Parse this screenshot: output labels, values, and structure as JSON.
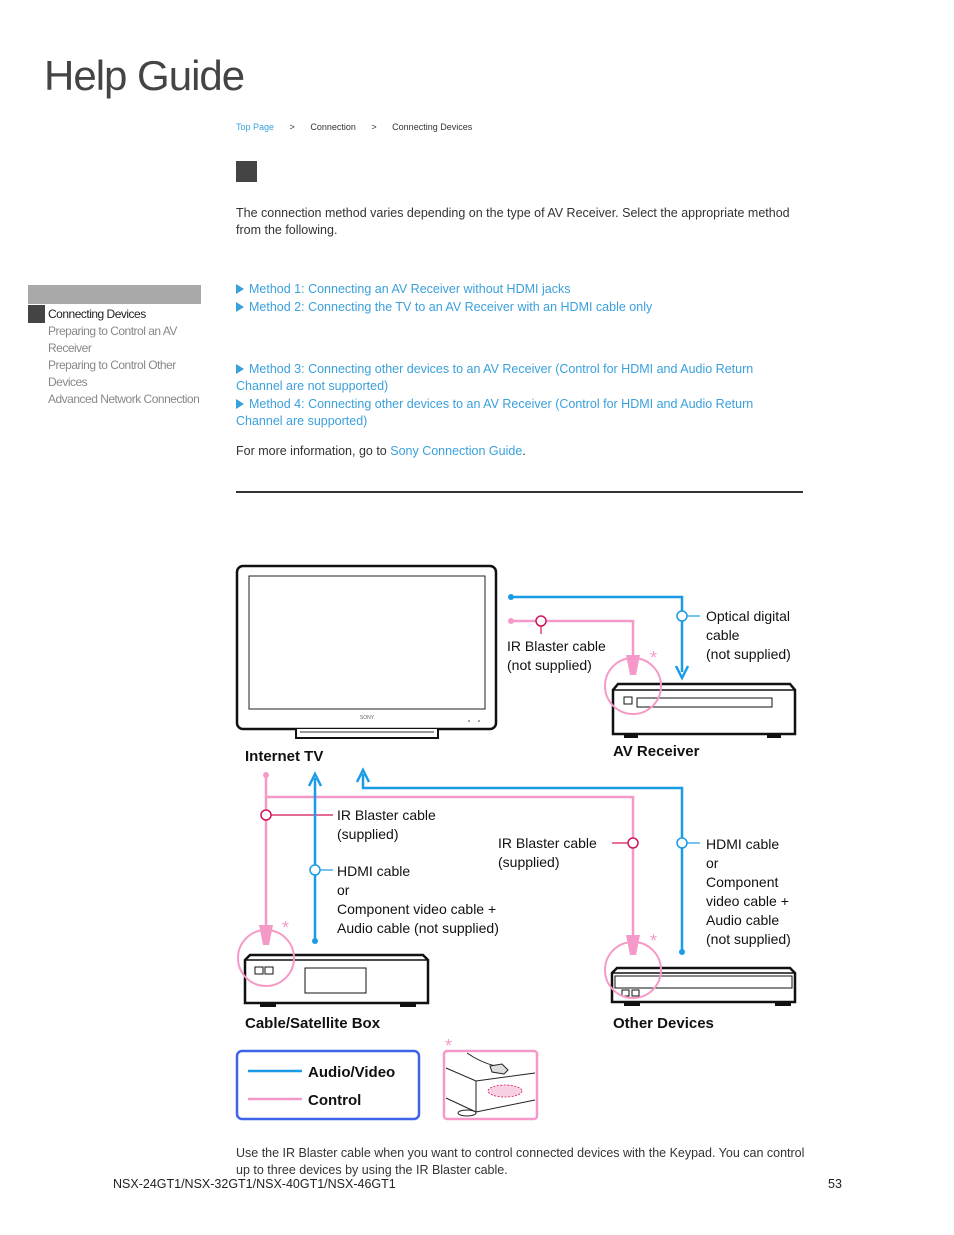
{
  "header": {
    "title": "Help Guide"
  },
  "breadcrumb": [
    {
      "label": "Top Page",
      "link": true
    },
    {
      "label": "Connection",
      "link": false
    },
    {
      "label": "Connecting Devices",
      "link": false
    }
  ],
  "breadcrumb_separator": ">",
  "intro": "The connection method varies depending on the type of AV Receiver. Select the appropriate method from the following.",
  "methods": [
    "Method 1: Connecting an AV Receiver without HDMI jacks",
    "Method 2: Connecting the TV to an AV Receiver with an HDMI cable only",
    "Method 3: Connecting other devices to an AV Receiver (Control for HDMI and Audio Return Channel are not supported)",
    "Method 4: Connecting other devices to an AV Receiver (Control for HDMI and Audio Return Channel are supported)"
  ],
  "more_info": {
    "prefix": "For more information, go to ",
    "link": "Sony Connection Guide",
    "suffix": "."
  },
  "sidebar": {
    "current": "Connecting Devices",
    "items": [
      "Preparing to Control an AV Receiver",
      "Preparing to Control Other Devices",
      "Advanced Network Connection"
    ]
  },
  "diagram": {
    "colors": {
      "av": "#1a9be6",
      "control": "#f59ac8",
      "control_dark": "#d4145a",
      "legend_border": "#3f63e6"
    },
    "devices": {
      "tv": "Internet TV",
      "receiver": "AV Receiver",
      "box": "Cable/Satellite Box",
      "other": "Other Devices",
      "tv_brand": "SONY"
    },
    "labels": {
      "ir_top": [
        "IR Blaster cable",
        "(not supplied)"
      ],
      "optical": [
        "Optical digital",
        "cable",
        "(not supplied)"
      ],
      "ir_left": [
        "IR Blaster cable",
        "(supplied)"
      ],
      "hdmi_left": [
        "HDMI cable",
        "or",
        "Component video cable +",
        "Audio cable (not supplied)"
      ],
      "ir_right": [
        "IR Blaster cable",
        "(supplied)"
      ],
      "hdmi_right": [
        "HDMI cable",
        "or",
        "Component",
        "video cable +",
        "Audio cable",
        "(not supplied)"
      ]
    },
    "asterisk": "*",
    "legend": {
      "av": "Audio/Video",
      "control": "Control"
    }
  },
  "note": "Use the IR Blaster cable when you want to control connected devices with the Keypad. You can control up to three devices by using the IR Blaster cable.",
  "footer": {
    "model": "NSX-24GT1/NSX-32GT1/NSX-40GT1/NSX-46GT1",
    "page": "53"
  }
}
